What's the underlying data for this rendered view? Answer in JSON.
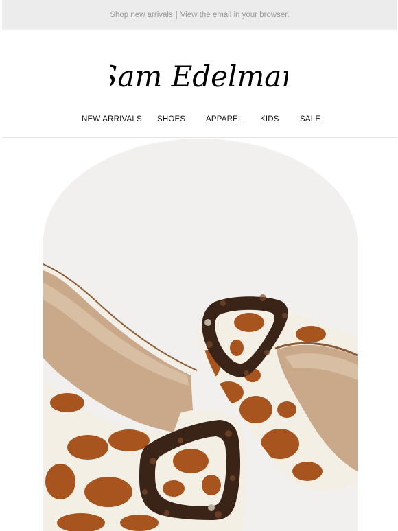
{
  "preheader": {
    "shop_link": "Shop new arrivals",
    "separator": "|",
    "browser_link": "View the email in your browser."
  },
  "logo": {
    "text": "Sam Edelman",
    "icon": "brand-script-logo"
  },
  "nav": {
    "items": [
      {
        "label": "NEW ARRIVALS"
      },
      {
        "label": "SHOES"
      },
      {
        "label": "APPAREL"
      },
      {
        "label": "KIDS"
      },
      {
        "label": "SALE"
      }
    ]
  },
  "hero": {
    "image": "giraffe-print-mules-with-tortoiseshell-buckles",
    "colors": {
      "background": "#f1f0ee",
      "print_base": "#f4efe5",
      "print_spots": "#a8541f",
      "tortoise": "#3a2418",
      "lining": "#c9a98a"
    }
  }
}
